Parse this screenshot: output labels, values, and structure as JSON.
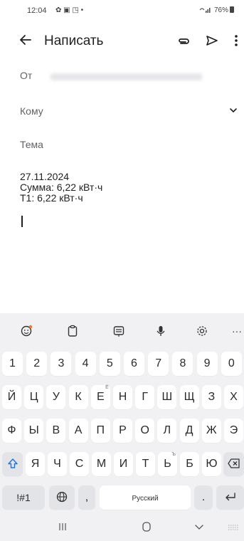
{
  "status": {
    "time": "12:04",
    "left_icons": "✿ ▣ ◳ •",
    "signal": "📶",
    "battery": "76%"
  },
  "appbar": {
    "title": "Написать"
  },
  "fields": {
    "from_label": "От",
    "to_label": "Кому",
    "subject_label": "Тема"
  },
  "body": {
    "lines": [
      "27.11.2024",
      "Сумма: 6,22 кВт·ч",
      "Т1: 6,22 кВт·ч"
    ]
  },
  "keyboard": {
    "toolbar": {
      "more": "···"
    },
    "numbers": [
      "1",
      "2",
      "3",
      "4",
      "5",
      "6",
      "7",
      "8",
      "9",
      "0"
    ],
    "row1": [
      "Й",
      "Ц",
      "У",
      "К",
      "Е",
      "Н",
      "Г",
      "Ш",
      "Щ",
      "З",
      "Х"
    ],
    "row1_hint": "Ё",
    "row2": [
      "Ф",
      "Ы",
      "В",
      "А",
      "П",
      "Р",
      "О",
      "Л",
      "Д",
      "Ж",
      "Э"
    ],
    "row3": [
      "Я",
      "Ч",
      "С",
      "М",
      "И",
      "Т",
      "Ь",
      "Б",
      "Ю"
    ],
    "row3_hint": "Ъ",
    "symbols_label": "!#1",
    "comma_label": ",",
    "space_label": "Русский",
    "period_label": "."
  },
  "colors": {
    "accent": "#1a73e8",
    "keyboard_bg": "#f1f1f4",
    "key": "#ffffff",
    "key_gray": "#e3e4e8"
  }
}
